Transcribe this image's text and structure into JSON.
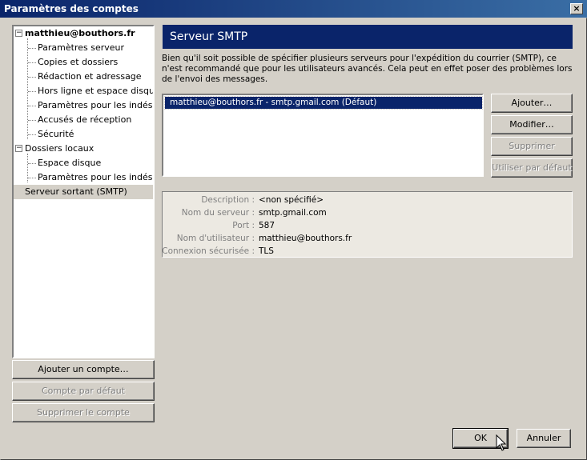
{
  "window": {
    "title": "Paramètres des comptes",
    "close_label": "×"
  },
  "tree": {
    "account": "matthieu@bouthors.fr",
    "account_items": [
      "Paramètres serveur",
      "Copies et dossiers",
      "Rédaction et adressage",
      "Hors ligne et espace disque",
      "Paramètres pour les indésir…",
      "Accusés de réception",
      "Sécurité"
    ],
    "local_folders": "Dossiers locaux",
    "local_items": [
      "Espace disque",
      "Paramètres pour les indésir…"
    ],
    "outgoing": "Serveur sortant (SMTP)",
    "expander_symbol": "−"
  },
  "left_buttons": {
    "add_account": "Ajouter un compte…",
    "default_account": "Compte par défaut",
    "delete_account": "Supprimer le compte"
  },
  "panel": {
    "header": "Serveur SMTP",
    "description": "Bien qu'il soit possible de spécifier plusieurs serveurs pour l'expédition du courrier (SMTP), ce n'est recommandé que pour les utilisateurs avancés. Cela peut en effet poser des problèmes lors de l'envoi des messages.",
    "servers": [
      "matthieu@bouthors.fr - smtp.gmail.com (Défaut)"
    ],
    "buttons": {
      "add": "Ajouter…",
      "edit": "Modifier…",
      "delete": "Supprimer",
      "set_default": "Utiliser par défaut"
    },
    "details": [
      {
        "label": "Description :",
        "value": "<non spécifié>"
      },
      {
        "label": "Nom du serveur :",
        "value": "smtp.gmail.com"
      },
      {
        "label": "Port :",
        "value": "587"
      },
      {
        "label": "Nom d'utilisateur :",
        "value": "matthieu@bouthors.fr"
      },
      {
        "label": "Connexion sécurisée :",
        "value": "TLS"
      }
    ]
  },
  "dialog_buttons": {
    "ok": "OK",
    "cancel": "Annuler"
  },
  "colors": {
    "titlebar": "#0a246a",
    "selection": "#0a246a",
    "face": "#d4d0c8"
  }
}
